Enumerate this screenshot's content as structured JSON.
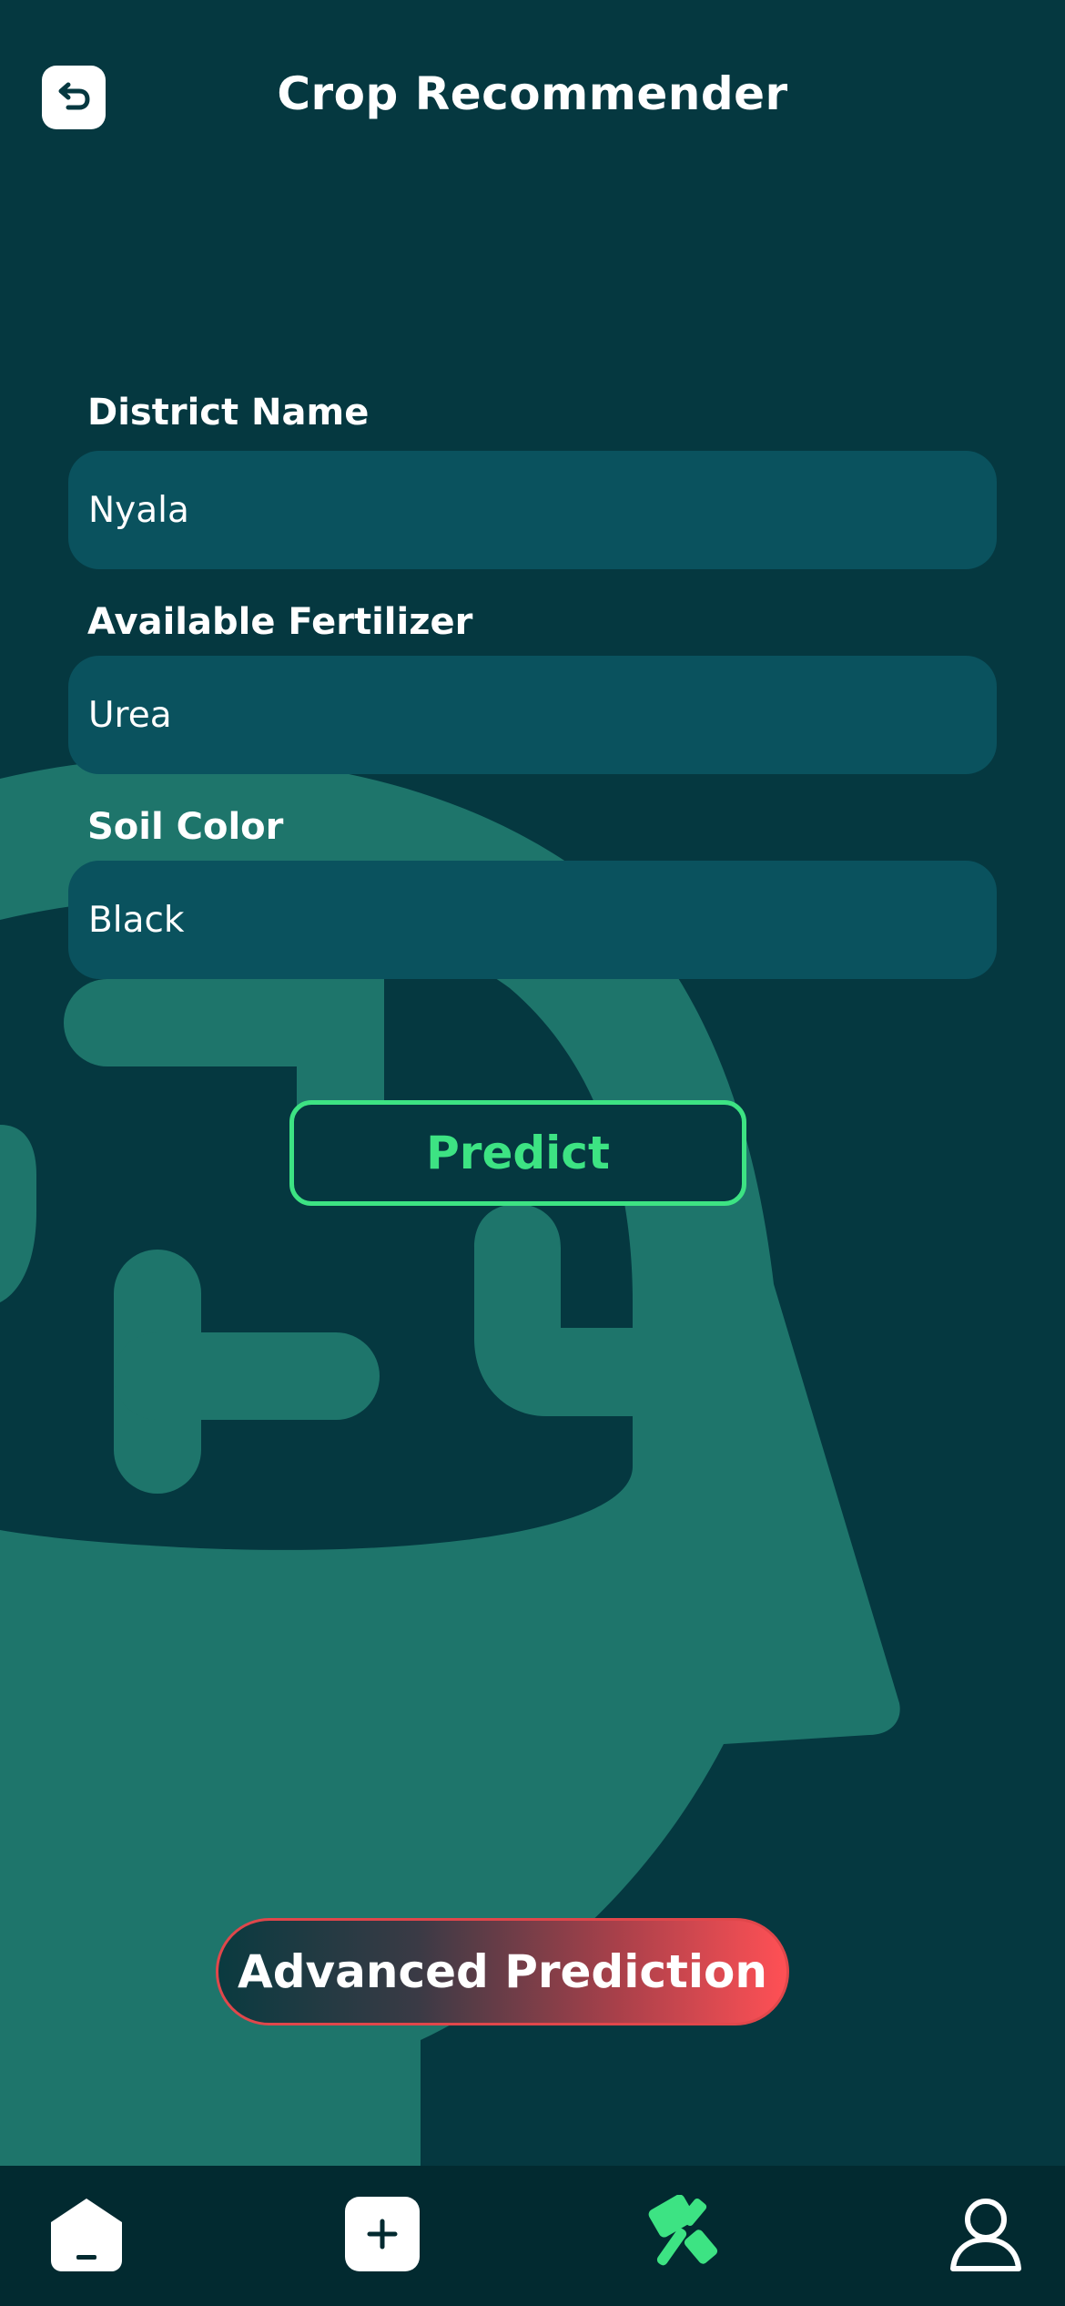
{
  "header": {
    "title": "Crop Recommender",
    "back_icon": "back-arrow-icon"
  },
  "form": {
    "district": {
      "label": "District Name",
      "value": "Nyala"
    },
    "fertilizer": {
      "label": "Available Fertilizer",
      "value": "Urea"
    },
    "soil": {
      "label": "Soil Color",
      "value": "Black"
    }
  },
  "buttons": {
    "predict": "Predict",
    "advanced": "Advanced Prediction"
  },
  "bottom_nav": {
    "items": [
      {
        "icon": "home-icon"
      },
      {
        "icon": "add-icon"
      },
      {
        "icon": "tools-icon",
        "active": true
      },
      {
        "icon": "profile-icon"
      }
    ]
  },
  "colors": {
    "background": "#053840",
    "field": "#0a525e",
    "decor": "#1e756b",
    "accent": "#3de383",
    "danger": "#ff5055",
    "nav": "#022a30"
  }
}
